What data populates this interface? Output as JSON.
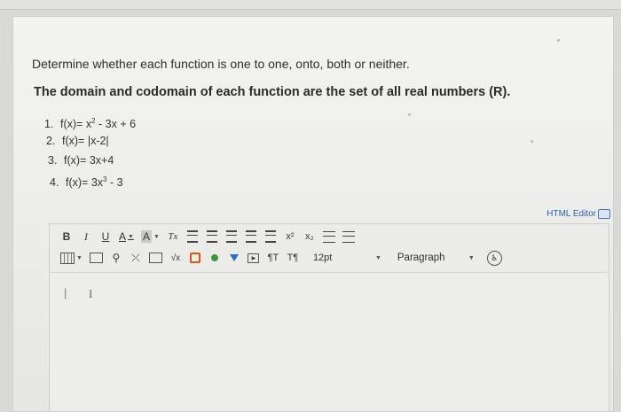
{
  "question": {
    "title": "Determine whether each function is one to one, onto, both or neither.",
    "subtitle": "The domain and codomain of each function are the set of all real numbers (R).",
    "items": [
      {
        "num": "1.",
        "pre": "f(x)= x",
        "sup": "2",
        "post": " - 3x + 6"
      },
      {
        "num": "2.",
        "pre": "f(x)= |x-2|",
        "sup": "",
        "post": ""
      },
      {
        "num": "3.",
        "pre": "f(x)= 3x+4",
        "sup": "",
        "post": ""
      },
      {
        "num": "4.",
        "pre": "f(x)= 3x",
        "sup": "3",
        "post": " - 3"
      }
    ]
  },
  "editor": {
    "html_editor_label": "HTML Editor",
    "toolbar": {
      "bold": "B",
      "italic": "I",
      "underline": "U",
      "font_color": "A",
      "bg_color": "A",
      "clear_format": "Tx",
      "superscript": "x²",
      "subscript": "x₂",
      "sqrt": "√x",
      "ltr": "¶T",
      "rtl": "T¶",
      "font_size": "12pt",
      "paragraph": "Paragraph",
      "a11y": "♿"
    },
    "cursor": "|",
    "ibeam": "I"
  }
}
